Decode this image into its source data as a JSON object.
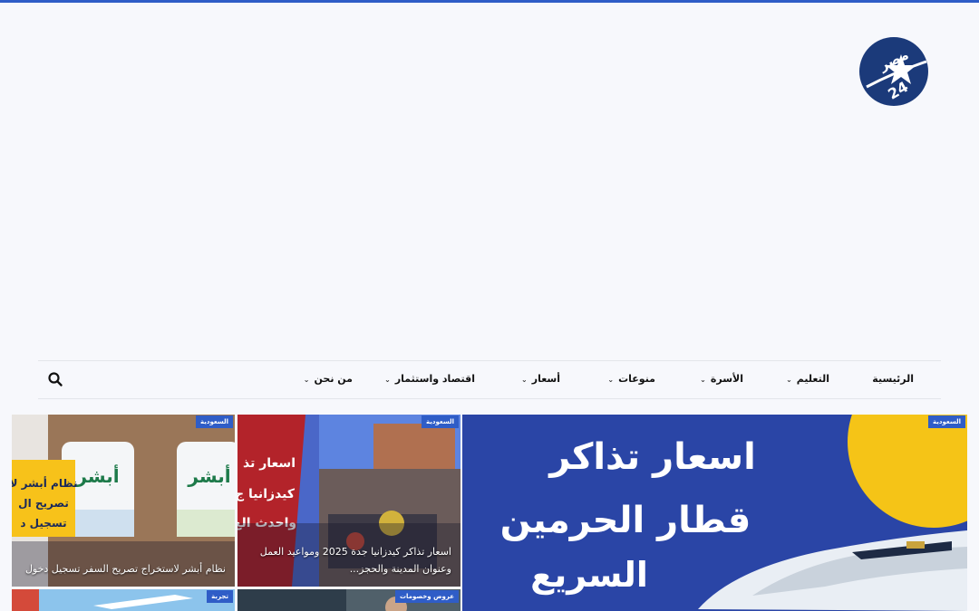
{
  "site": {
    "logo_top": "مصر",
    "logo_number": "24",
    "brand_color": "#2f5dc7",
    "logo_color": "#1b3a7a"
  },
  "nav": {
    "items": [
      {
        "label": "الرئيسية",
        "has_dropdown": false
      },
      {
        "label": "التعليم",
        "has_dropdown": true
      },
      {
        "label": "الأسرة",
        "has_dropdown": true
      },
      {
        "label": "منوعات",
        "has_dropdown": true
      },
      {
        "label": "أسعار",
        "has_dropdown": true
      },
      {
        "label": "اقتصاد واستثمار",
        "has_dropdown": true
      },
      {
        "label": "من نحن",
        "has_dropdown": true
      }
    ],
    "search_icon": "search-icon"
  },
  "featured": {
    "main": {
      "badge": "السعودية",
      "image_lines": [
        "اسعار تذاكر",
        "قطار الحرمين",
        "السريع"
      ]
    },
    "card1": {
      "badge": "السعودية",
      "title": "اسعار تذاكر كيدزانيا جدة 2025 ومواعيد العمل وعنوان المدينة والحجز..."
    },
    "card2": {
      "badge": "السعودية",
      "title": "نظام أبشر لاستخراج تصريح السفر تسجيل دخول"
    },
    "card3": {
      "badge": "عروض وخصومات"
    },
    "card4": {
      "badge": "تجربة"
    }
  }
}
